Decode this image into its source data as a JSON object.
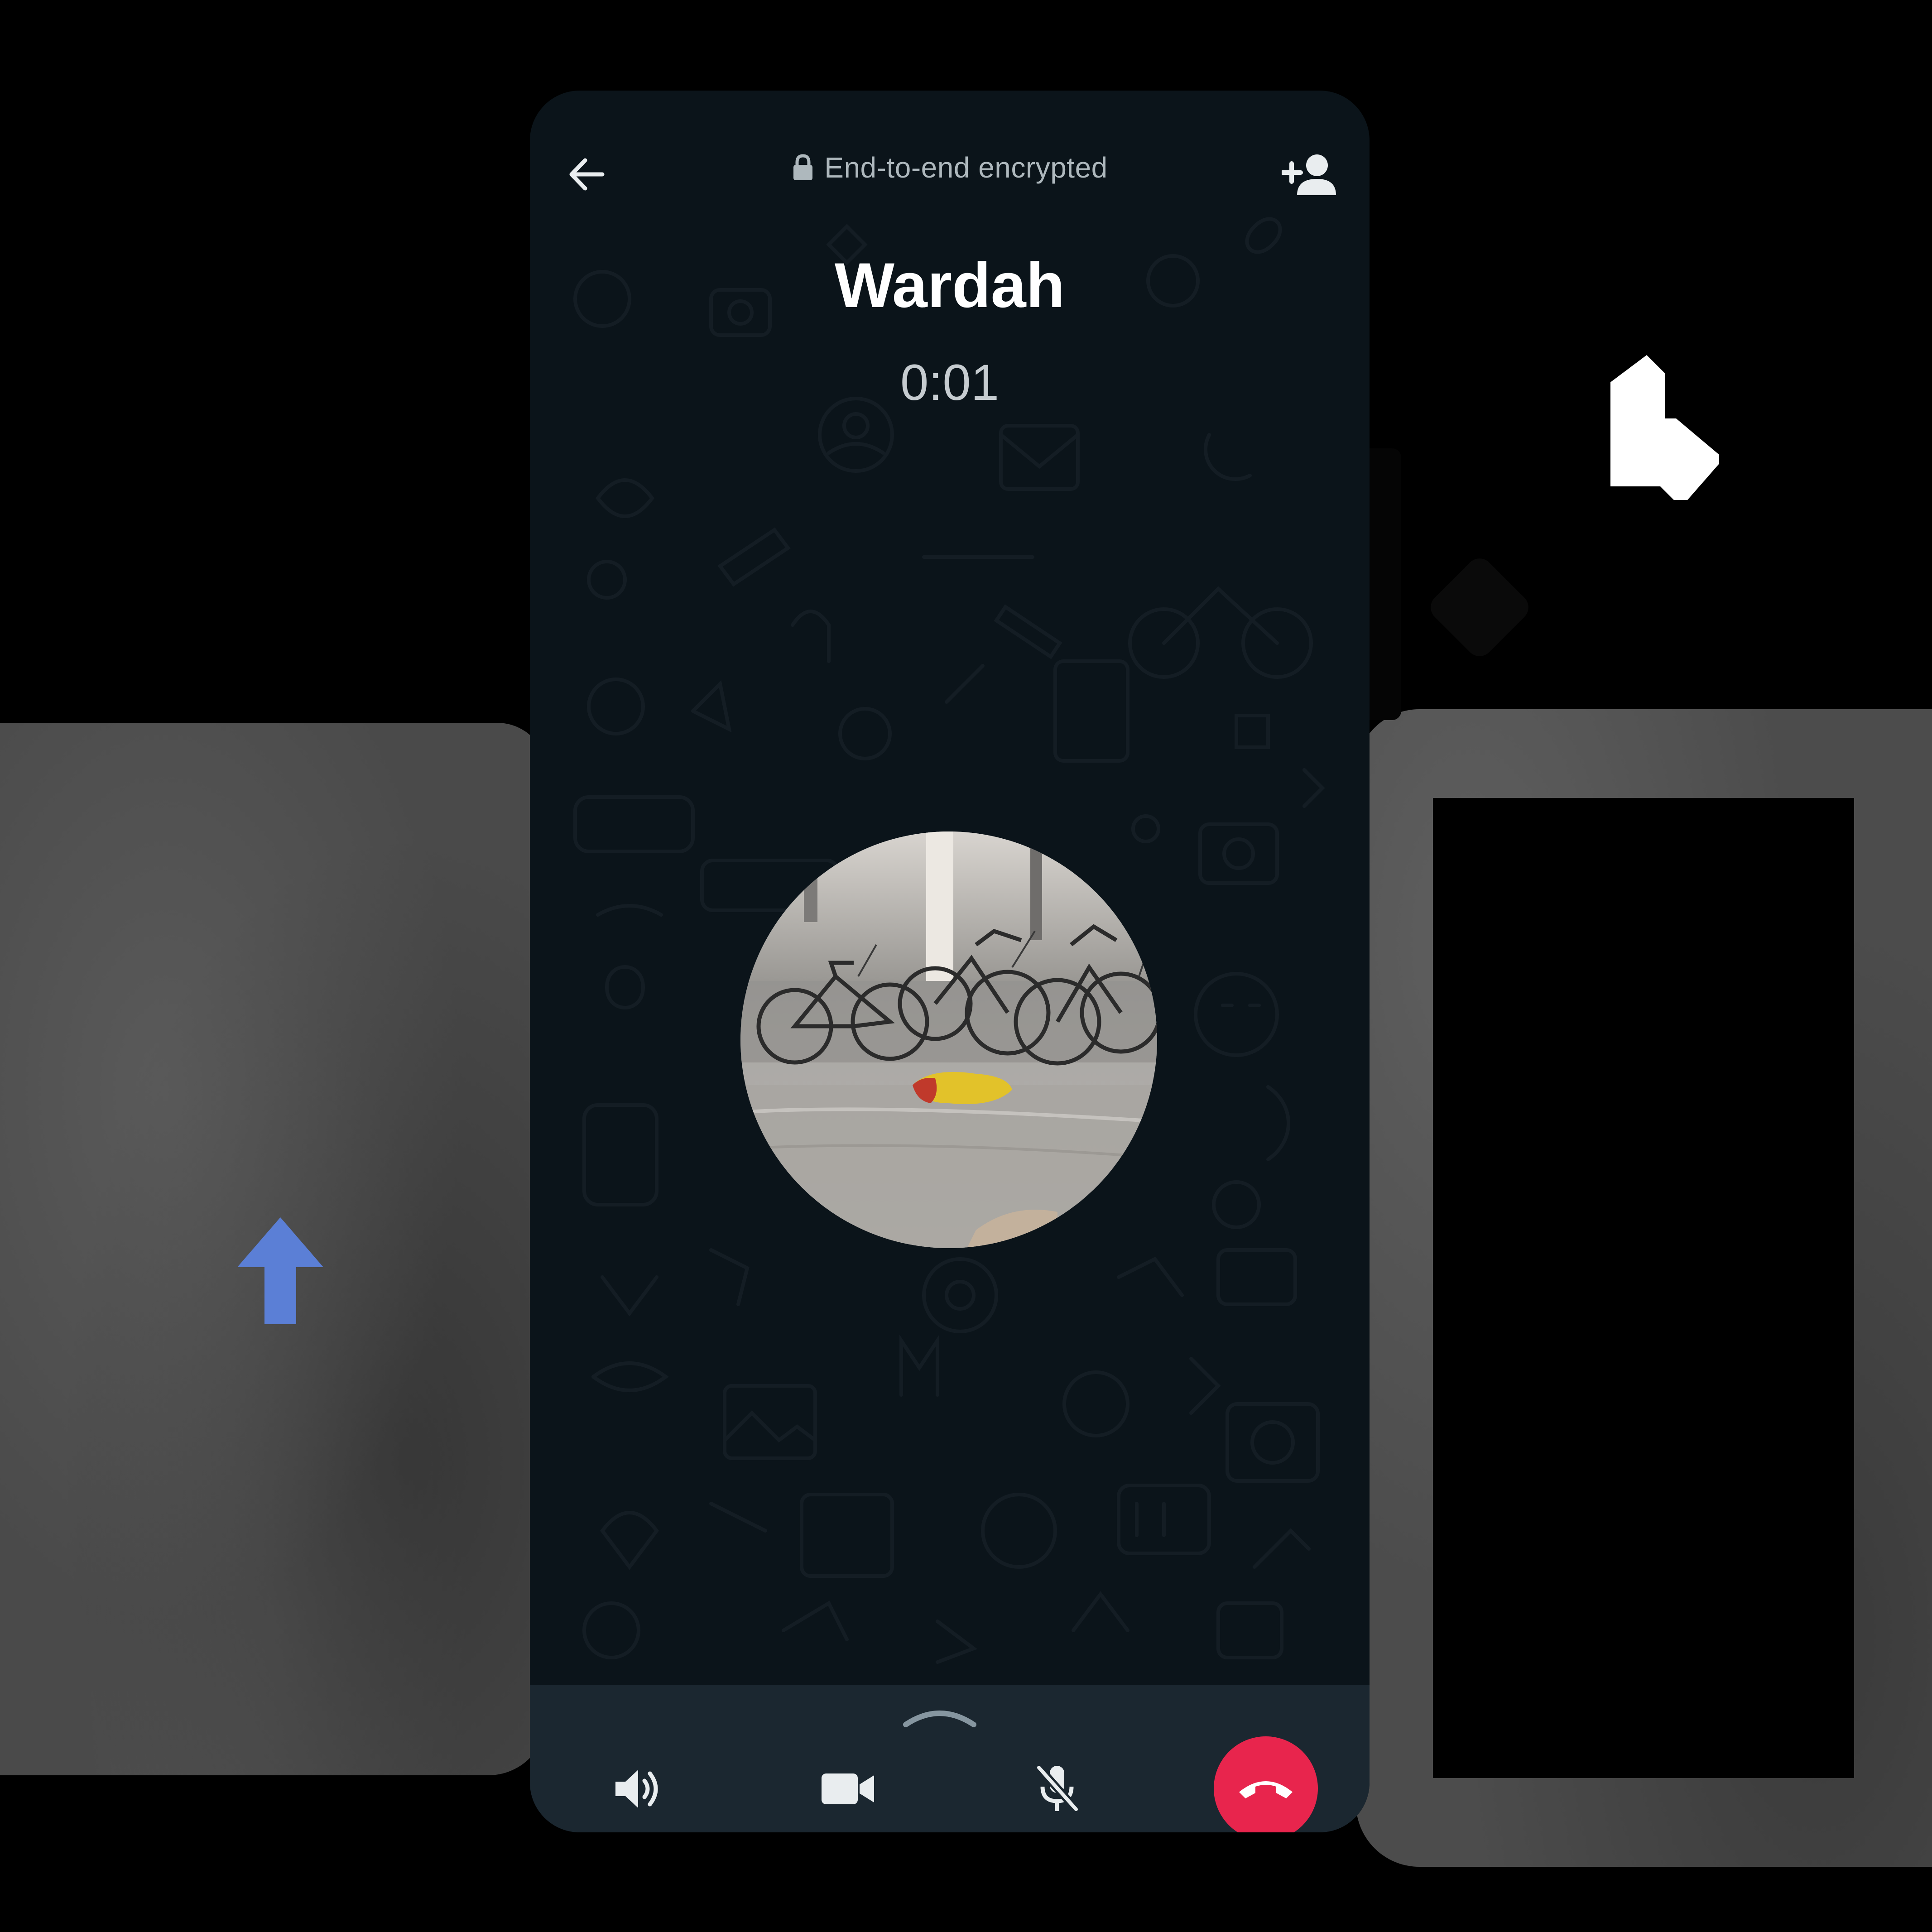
{
  "call": {
    "encryption_notice": "End-to-end encrypted",
    "contact_name": "Wardah",
    "duration": "0:01"
  },
  "icons": {
    "back": "arrow-left-icon",
    "lock": "lock-icon",
    "add_participant": "add-person-icon",
    "expand": "chevron-up-icon",
    "speaker": "speaker-icon",
    "video": "video-camera-icon",
    "mute": "microphone-off-icon",
    "end_call": "phone-hangup-icon",
    "overlay_arrow": "arrow-up-icon"
  },
  "colors": {
    "background": "#0b141a",
    "sheet": "#1b2730",
    "end_call": "#e8254d",
    "arrow_accent": "#5b7fd6",
    "text_primary": "#ffffff",
    "text_secondary": "#aeb8bd"
  }
}
